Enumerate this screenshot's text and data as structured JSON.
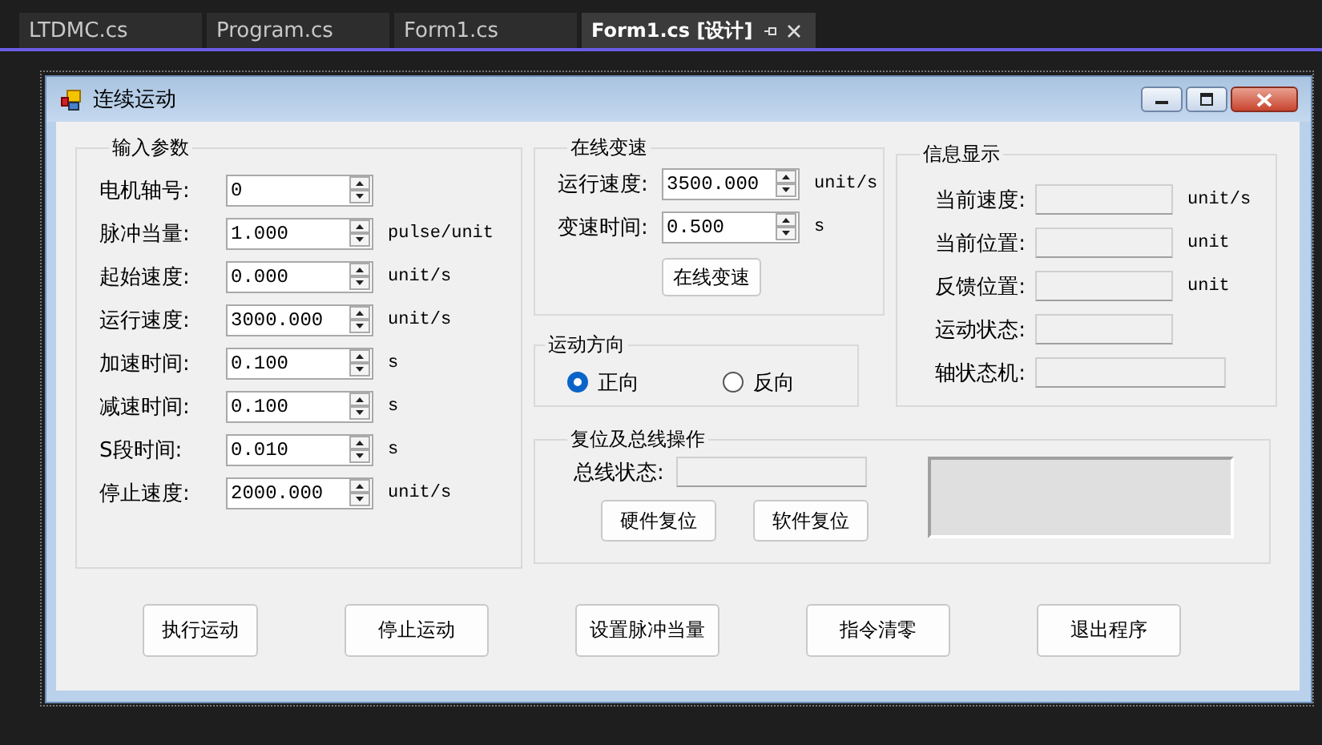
{
  "tabs": [
    {
      "label": "LTDMC.cs",
      "selected": false
    },
    {
      "label": "Program.cs",
      "selected": false
    },
    {
      "label": "Form1.cs",
      "selected": false
    },
    {
      "label": "Form1.cs [设计]",
      "selected": true
    }
  ],
  "form": {
    "title": "连续运动",
    "input_params": {
      "title": "输入参数",
      "rows": [
        {
          "label": "电机轴号:",
          "value": "0"
        },
        {
          "label": "脉冲当量:",
          "value": "1.000",
          "unit": "pulse/unit"
        },
        {
          "label": "起始速度:",
          "value": "0.000",
          "unit": "unit/s"
        },
        {
          "label": "运行速度:",
          "value": "3000.000",
          "unit": "unit/s"
        },
        {
          "label": "加速时间:",
          "value": "0.100",
          "unit": "s"
        },
        {
          "label": "减速时间:",
          "value": "0.100",
          "unit": "s"
        },
        {
          "label": "S段时间:",
          "value": "0.010",
          "unit": "s"
        },
        {
          "label": "停止速度:",
          "value": "2000.000",
          "unit": "unit/s"
        }
      ]
    },
    "online_speed": {
      "title": "在线变速",
      "rows": [
        {
          "label": "运行速度:",
          "value": "3500.000",
          "unit": "unit/s"
        },
        {
          "label": "变速时间:",
          "value": "0.500",
          "unit": "s"
        }
      ],
      "button": "在线变速"
    },
    "direction": {
      "title": "运动方向",
      "options": [
        {
          "label": "正向",
          "selected": true
        },
        {
          "label": "反向",
          "selected": false
        }
      ]
    },
    "info": {
      "title": "信息显示",
      "rows": [
        {
          "label": "当前速度:",
          "unit": "unit/s",
          "wide": false
        },
        {
          "label": "当前位置:",
          "unit": "unit",
          "wide": false
        },
        {
          "label": "反馈位置:",
          "unit": "unit",
          "wide": false
        },
        {
          "label": "运动状态:",
          "wide": false
        },
        {
          "label": "轴状态机:",
          "wide": true
        }
      ]
    },
    "reset": {
      "title": "复位及总线操作",
      "bus_label": "总线状态:",
      "buttons": [
        "硬件复位",
        "软件复位"
      ]
    },
    "buttons": [
      "执行运动",
      "停止运动",
      "设置脉冲当量",
      "指令清零",
      "退出程序"
    ]
  }
}
